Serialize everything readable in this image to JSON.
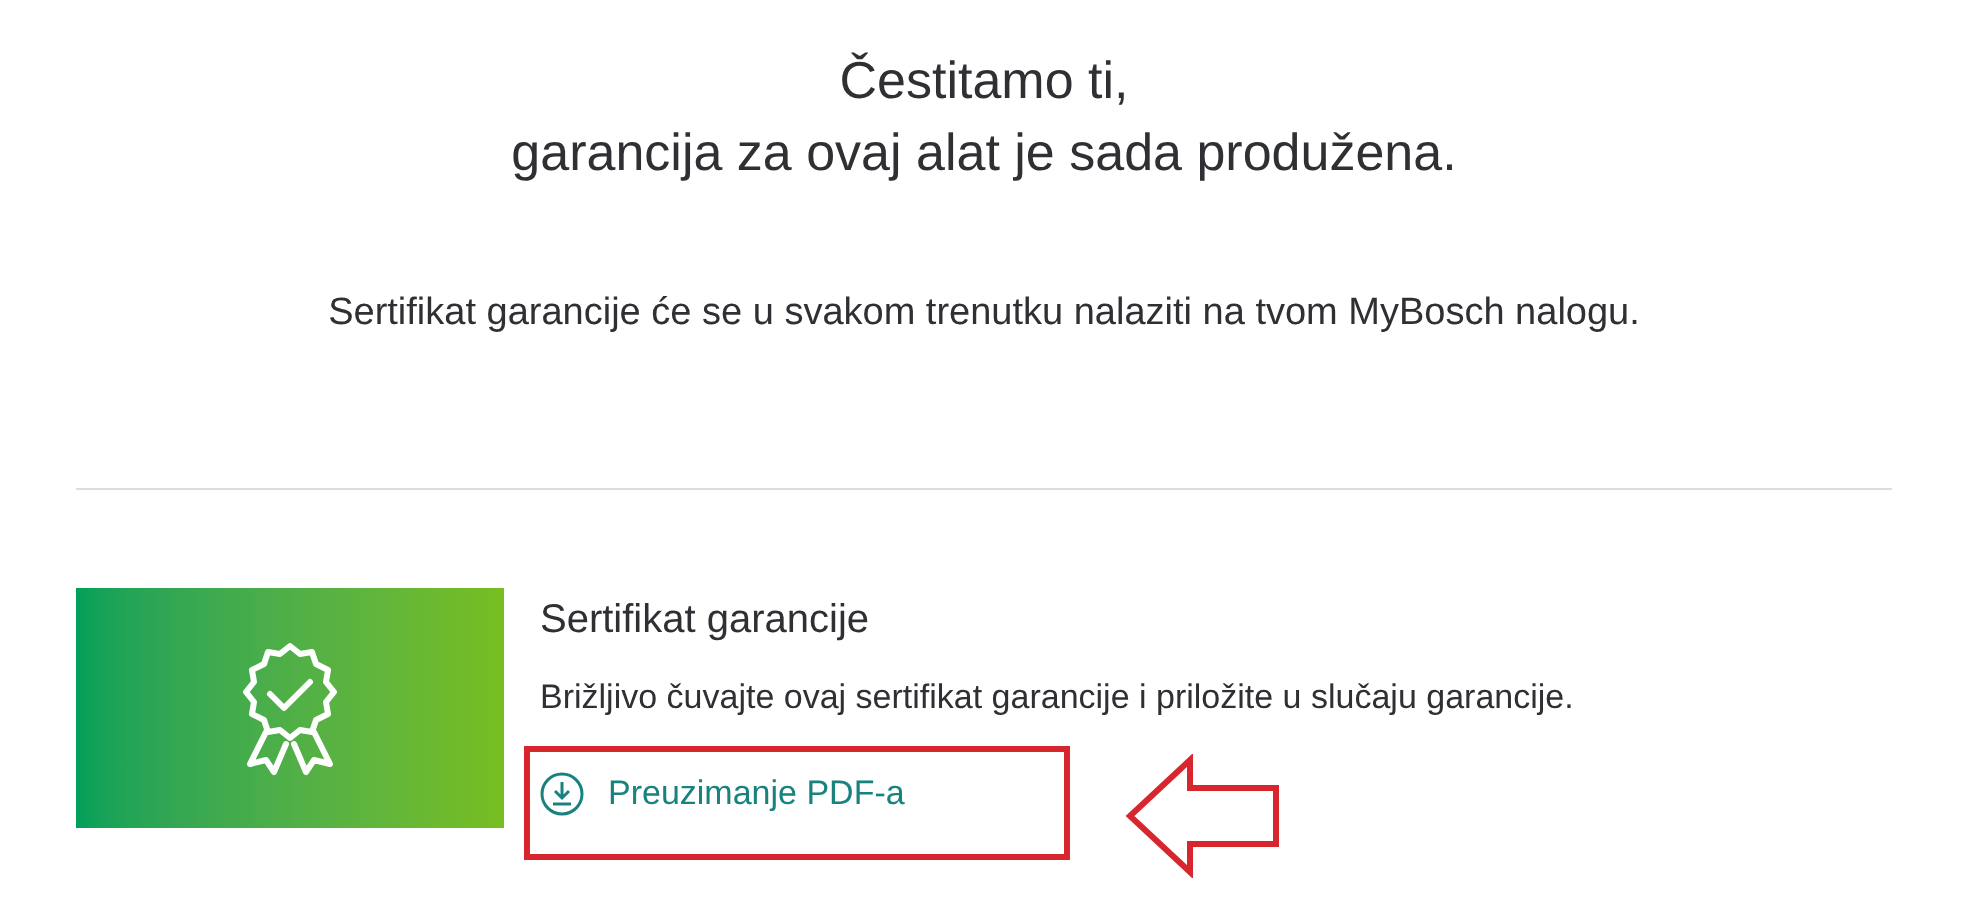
{
  "heading": {
    "lines": [
      "Čestitamo ti,",
      "garancija za ovaj alat je sada produžena."
    ]
  },
  "note": "Sertifikat garancije će se u svakom trenutku nalaziti na tvom MyBosch nalogu.",
  "certificate": {
    "title": "Sertifikat garancije",
    "description": "Brižljivo čuvajte ovaj sertifikat garancije i priložite u slučaju garancije.",
    "download_link": "Preuzimanje PDF-a",
    "highlighted": true
  }
}
